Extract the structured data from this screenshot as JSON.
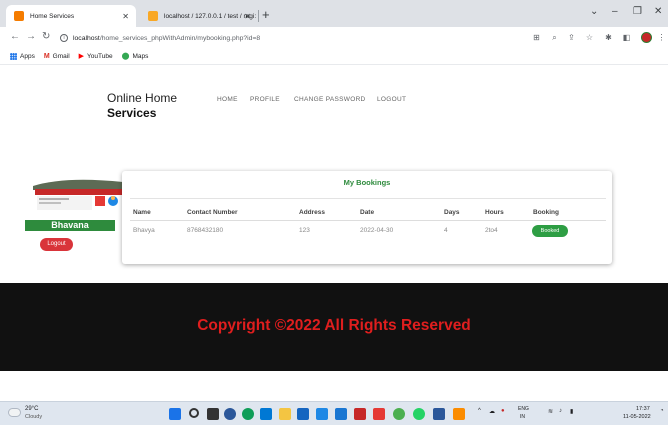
{
  "browser": {
    "tabs": [
      {
        "label": "Home Services",
        "active": true,
        "favicon_color": "#f57c00"
      },
      {
        "label": "localhost / 127.0.0.1 / test / regi:",
        "active": false,
        "favicon_color": "#f9a825"
      }
    ],
    "address": {
      "host": "localhost",
      "path": "/home_services_phpWithAdmin/mybooking.php?id=8"
    },
    "bookmarks": [
      {
        "label": "Apps",
        "icon": "apps-grid-icon"
      },
      {
        "label": "Gmail",
        "icon": "gmail-icon"
      },
      {
        "label": "YouTube",
        "icon": "youtube-icon"
      },
      {
        "label": "Maps",
        "icon": "maps-icon"
      }
    ]
  },
  "site": {
    "brand_line1": "Online Home",
    "brand_line2": "Services",
    "nav": [
      "HOME",
      "PROFILE",
      "CHANGE PASSWORD",
      "LOGOUT"
    ]
  },
  "sidebar": {
    "user_name": "Bhavana",
    "logout_label": "Logout"
  },
  "bookings": {
    "title": "My Bookings",
    "columns": [
      "Name",
      "Contact Number",
      "Address",
      "Date",
      "Days",
      "Hours",
      "Booking"
    ],
    "rows": [
      {
        "name": "Bhavya",
        "contact": "8768432180",
        "address": "123",
        "date": "2022-04-30",
        "days": "4",
        "hours": "2to4",
        "status": "Booked"
      }
    ]
  },
  "footer": {
    "copyright": "Copyright ©2022 All Rights Reserved"
  },
  "taskbar": {
    "temperature": "29°C",
    "weather": "Cloudy",
    "lang_top": "ENG",
    "lang_bottom": "IN",
    "time": "17:37",
    "date": "11-05-2022"
  },
  "colors": {
    "accent_green": "#2e8b3d",
    "logout_red": "#d9343a",
    "footer_bg": "#111111",
    "copyright_red": "#e01e1e"
  }
}
